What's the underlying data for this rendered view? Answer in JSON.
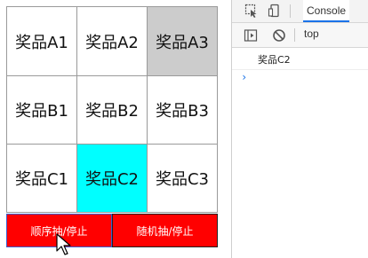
{
  "grid": [
    {
      "label": "奖品A1",
      "bg": "#ffffff"
    },
    {
      "label": "奖品A2",
      "bg": "#ffffff"
    },
    {
      "label": "奖品A3",
      "bg": "#cccccc"
    },
    {
      "label": "奖品B1",
      "bg": "#ffffff"
    },
    {
      "label": "奖品B2",
      "bg": "#ffffff"
    },
    {
      "label": "奖品B3",
      "bg": "#ffffff"
    },
    {
      "label": "奖品C1",
      "bg": "#ffffff"
    },
    {
      "label": "奖品C2",
      "bg": "#00ffff"
    },
    {
      "label": "奖品C3",
      "bg": "#ffffff"
    }
  ],
  "buttons": {
    "sequential": "顺序抽/停止",
    "random": "随机抽/停止",
    "color": "#ff0000"
  },
  "devtools": {
    "tab_console": "Console",
    "context": "top",
    "log_message": "奖品C2",
    "prompt": "›",
    "accent": "#1a73e8"
  }
}
